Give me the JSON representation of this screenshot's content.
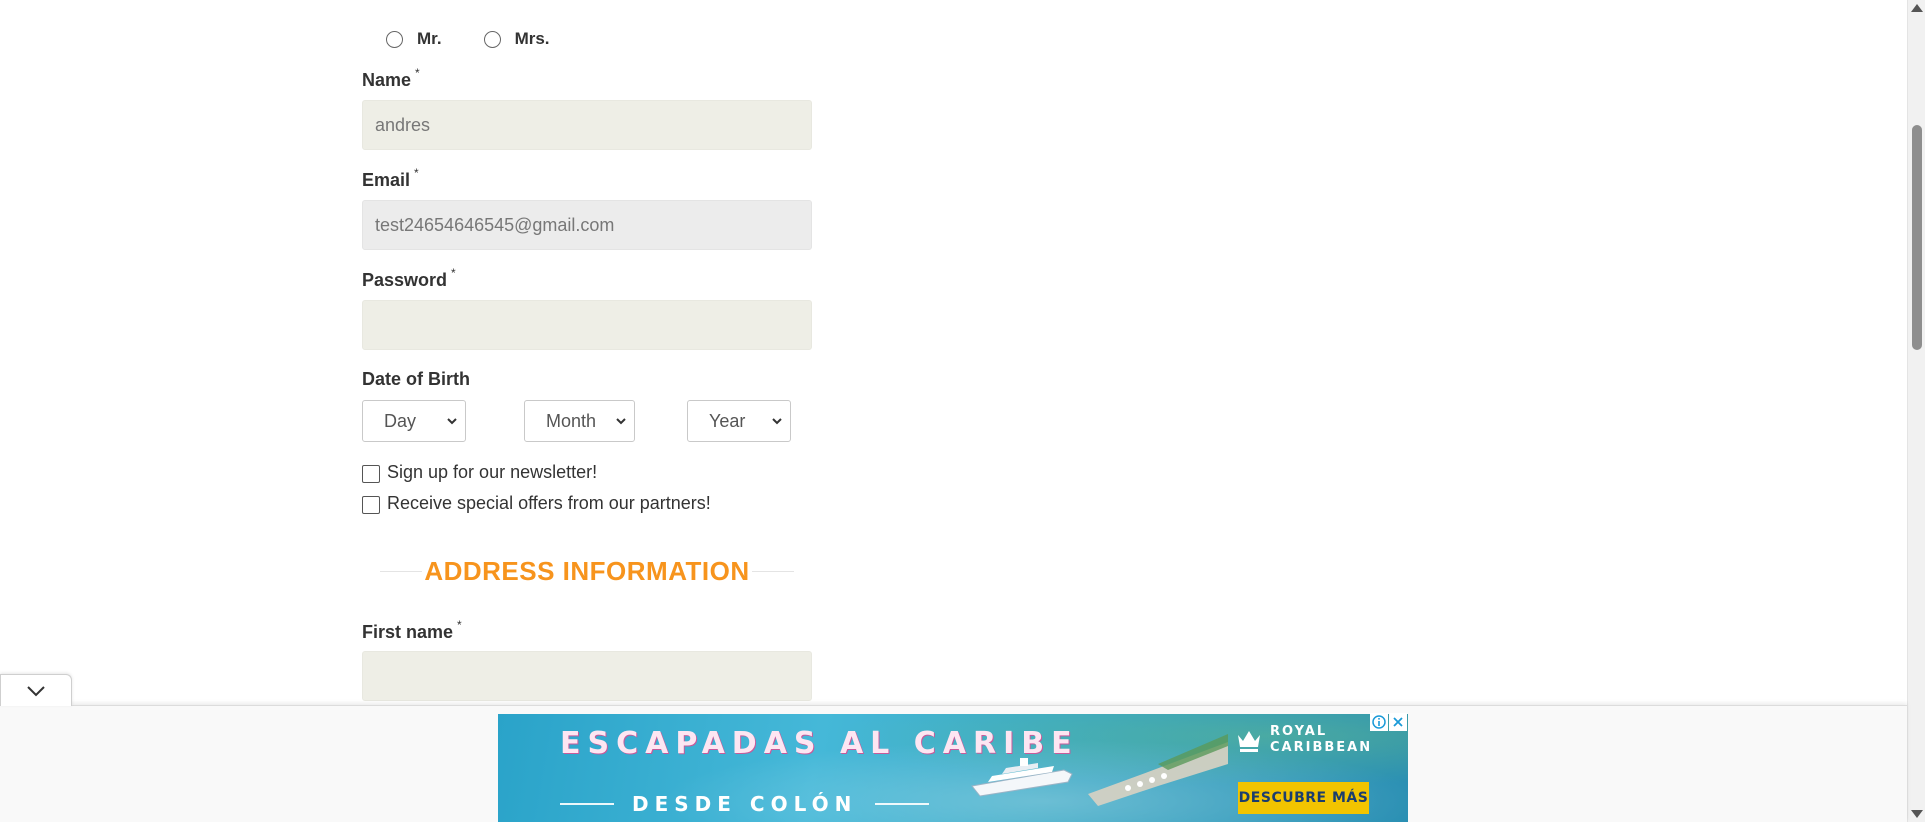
{
  "title_radio": {
    "options": [
      "Mr.",
      "Mrs."
    ]
  },
  "fields": {
    "name": {
      "label": "Name",
      "required_mark": "*",
      "value": "andres"
    },
    "email": {
      "label": "Email",
      "required_mark": "*",
      "value": "test24654646545@gmail.com"
    },
    "password": {
      "label": "Password",
      "required_mark": "*",
      "value": ""
    }
  },
  "dob": {
    "label": "Date of Birth",
    "day": "Day",
    "month": "Month",
    "year": "Year"
  },
  "checkboxes": {
    "newsletter": "Sign up for our newsletter!",
    "offers": "Receive special offers from our partners!"
  },
  "address_section": {
    "title": "ADDRESS INFORMATION",
    "first_name": {
      "label": "First name",
      "required_mark": "*",
      "value": ""
    }
  },
  "ad": {
    "headline": "ESCAPADAS AL CARIBE",
    "subline": "DESDE COLÓN",
    "brand_line1": "ROYAL",
    "brand_line2": "CARIBBEAN",
    "cta": "DESCUBRE MÁS"
  },
  "colors": {
    "accent_orange": "#f7941d",
    "input_bg": "#eeeee6",
    "cta_yellow": "#f2c400"
  }
}
